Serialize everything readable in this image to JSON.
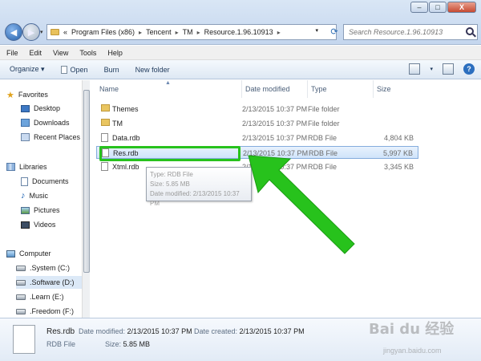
{
  "window": {
    "minimize_label": "–",
    "maximize_label": "□",
    "close_label": "X"
  },
  "address": {
    "breadcrumb": [
      "«",
      "Program Files (x86)",
      "Tencent",
      "TM",
      "Resource.1.96.10913"
    ]
  },
  "search": {
    "placeholder": "Search Resource.1.96.10913"
  },
  "menu": [
    "File",
    "Edit",
    "View",
    "Tools",
    "Help"
  ],
  "toolbar": {
    "organize": "Organize ▾",
    "open": "Open",
    "burn": "Burn",
    "new_folder": "New folder",
    "help": "?"
  },
  "sidebar": {
    "favorites": "Favorites",
    "desktop": "Desktop",
    "downloads": "Downloads",
    "recent": "Recent Places",
    "libraries": "Libraries",
    "documents": "Documents",
    "music": "Music",
    "pictures": "Pictures",
    "videos": "Videos",
    "computer": "Computer",
    "drive_c": ".System (C:)",
    "drive_d": ".Software (D:)",
    "drive_e": ".Learn (E:)",
    "drive_f": ".Freedom (F:)"
  },
  "columns": {
    "name": "Name",
    "date": "Date modified",
    "type": "Type",
    "size": "Size"
  },
  "files": [
    {
      "name": "Themes",
      "date": "2/13/2015 10:37 PM",
      "type": "File folder",
      "size": "",
      "icon": "folder-icon"
    },
    {
      "name": "TM",
      "date": "2/13/2015 10:37 PM",
      "type": "File folder",
      "size": "",
      "icon": "folder-icon"
    },
    {
      "name": "Data.rdb",
      "date": "2/13/2015 10:37 PM",
      "type": "RDB File",
      "size": "4,804 KB",
      "icon": "file-icon"
    },
    {
      "name": "Res.rdb",
      "date": "2/13/2015 10:37 PM",
      "type": "RDB File",
      "size": "5,997 KB",
      "icon": "file-icon"
    },
    {
      "name": "Xtml.rdb",
      "date": "2/13/2015 10:37 PM",
      "type": "RDB File",
      "size": "3,345 KB",
      "icon": "file-icon"
    }
  ],
  "tooltip": {
    "type": "Type: RDB File",
    "size": "Size: 5.85 MB",
    "date": "Date modified: 2/13/2015 10:37 PM"
  },
  "details": {
    "name": "Res.rdb",
    "type": "RDB File",
    "modified_label": "Date modified:",
    "modified": "2/13/2015 10:37 PM",
    "created_label": "Date created:",
    "created": "2/13/2015 10:37 PM",
    "size_label": "Size:",
    "size": "5.85 MB"
  },
  "watermark": {
    "main": "Bai du 经验",
    "sub": "jingyan.baidu.com"
  },
  "colors": {
    "highlight_green": "#27c21c",
    "selection_blue": "#cfe3fa"
  }
}
